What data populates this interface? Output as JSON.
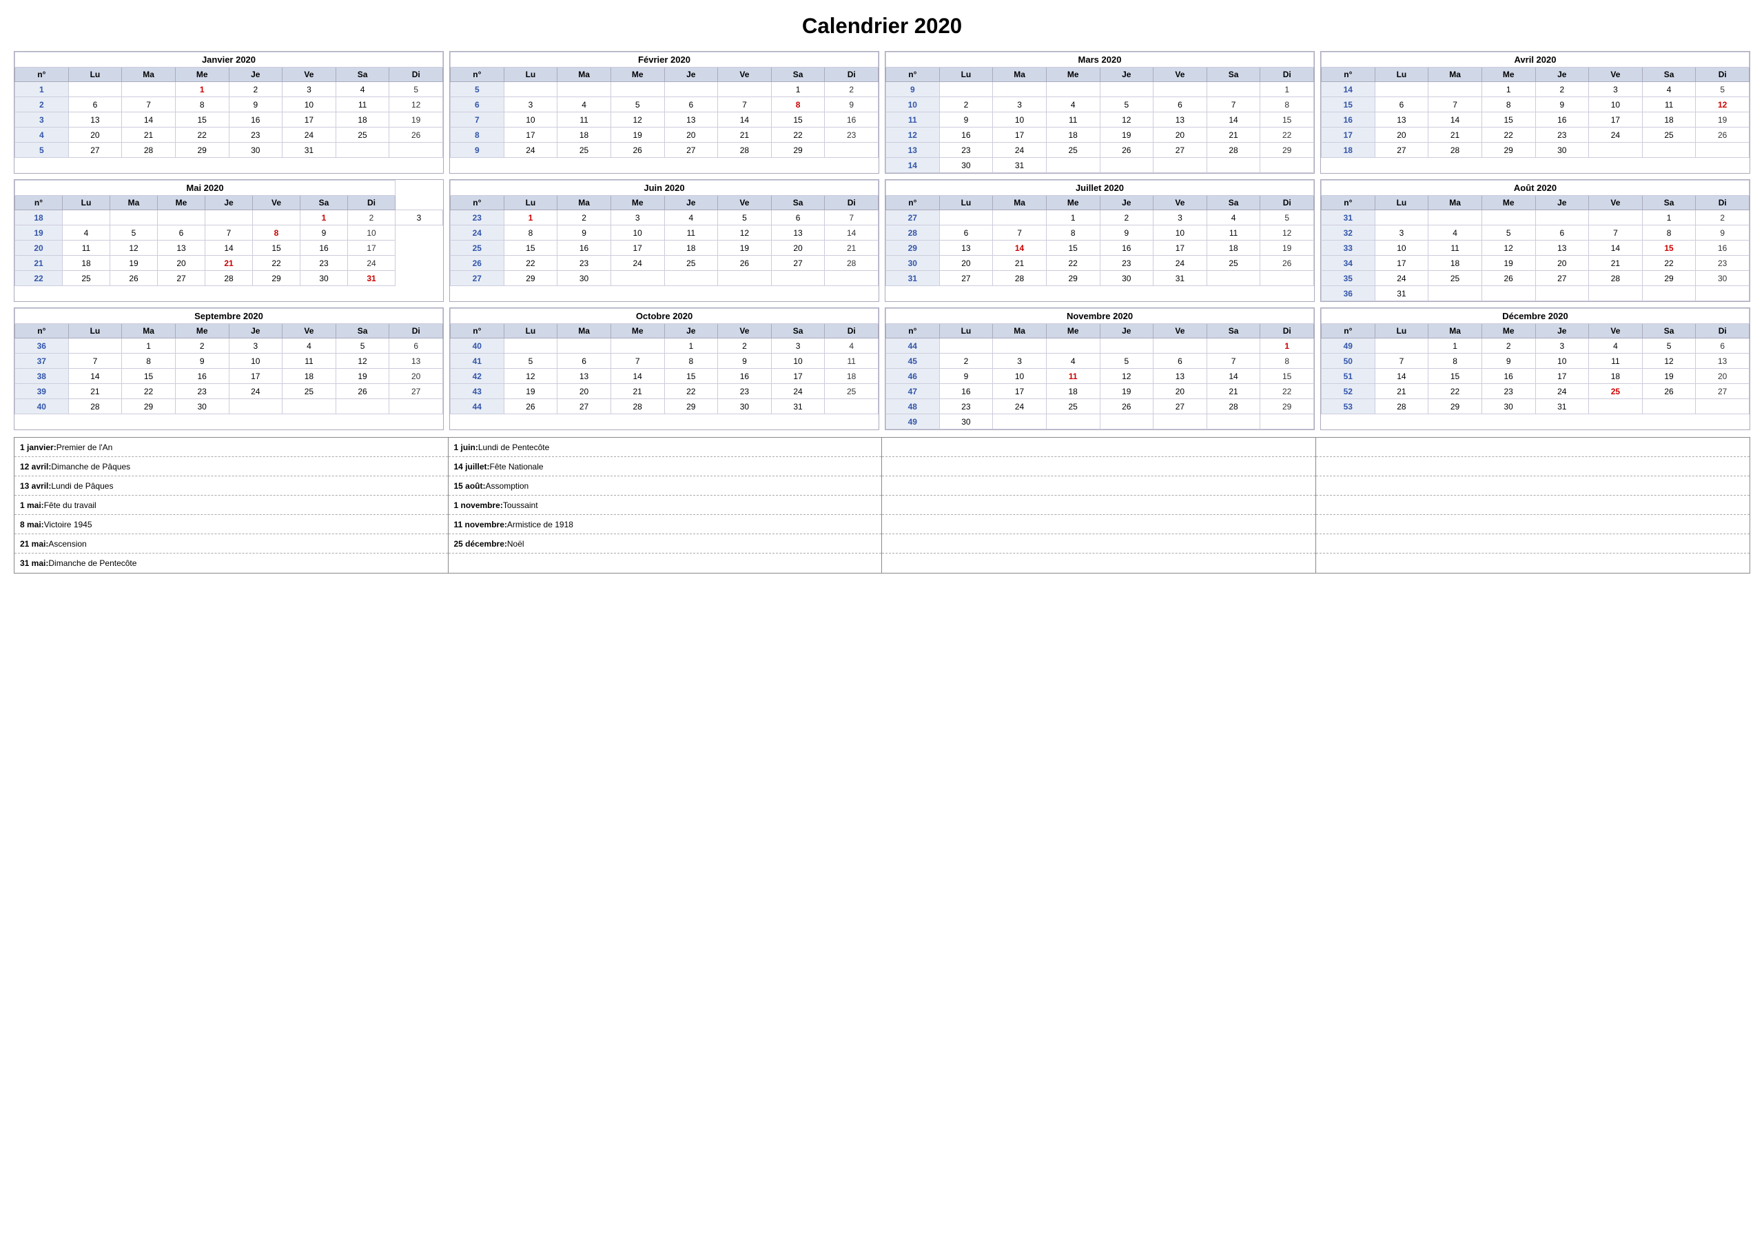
{
  "title": "Calendrier 2020",
  "months": [
    {
      "name": "Janvier 2020",
      "weeks": [
        {
          "wn": 1,
          "days": [
            "",
            "",
            "",
            "1r",
            "2",
            "3",
            "4",
            "5"
          ]
        },
        {
          "wn": 2,
          "days": [
            "",
            "6",
            "7",
            "8",
            "9",
            "10",
            "11",
            "12"
          ]
        },
        {
          "wn": 3,
          "days": [
            "",
            "13",
            "14",
            "15",
            "16",
            "17",
            "18",
            "19"
          ]
        },
        {
          "wn": 4,
          "days": [
            "",
            "20",
            "21",
            "22",
            "23",
            "24",
            "25",
            "26"
          ]
        },
        {
          "wn": 5,
          "days": [
            "",
            "27",
            "28",
            "29",
            "30",
            "31",
            "",
            ""
          ]
        }
      ]
    },
    {
      "name": "Février 2020",
      "weeks": [
        {
          "wn": 5,
          "days": [
            "",
            "",
            "",
            "",
            "",
            "",
            "1",
            "2"
          ]
        },
        {
          "wn": 6,
          "days": [
            "",
            "3",
            "4",
            "5",
            "6",
            "7",
            "8r",
            "9"
          ]
        },
        {
          "wn": 7,
          "days": [
            "",
            "10",
            "11",
            "12",
            "13",
            "14",
            "15",
            "16"
          ]
        },
        {
          "wn": 8,
          "days": [
            "",
            "17",
            "18",
            "19",
            "20",
            "21",
            "22",
            "23"
          ]
        },
        {
          "wn": 9,
          "days": [
            "",
            "24",
            "25",
            "26",
            "27",
            "28",
            "29",
            ""
          ]
        }
      ]
    },
    {
      "name": "Mars 2020",
      "weeks": [
        {
          "wn": 9,
          "days": [
            "",
            "",
            "",
            "",
            "",
            "",
            "",
            "1"
          ]
        },
        {
          "wn": 10,
          "days": [
            "",
            "2",
            "3",
            "4",
            "5",
            "6",
            "7",
            "8"
          ]
        },
        {
          "wn": 11,
          "days": [
            "",
            "9",
            "10",
            "11",
            "12",
            "13",
            "14",
            "15"
          ]
        },
        {
          "wn": 12,
          "days": [
            "",
            "16",
            "17",
            "18",
            "19",
            "20",
            "21",
            "22"
          ]
        },
        {
          "wn": 13,
          "days": [
            "",
            "23",
            "24",
            "25",
            "26",
            "27",
            "28",
            "29"
          ]
        },
        {
          "wn": 14,
          "days": [
            "",
            "30",
            "31",
            "",
            "",
            "",
            "",
            ""
          ]
        }
      ]
    },
    {
      "name": "Avril 2020",
      "weeks": [
        {
          "wn": 14,
          "days": [
            "",
            "",
            "",
            "1",
            "2",
            "3",
            "4",
            "5"
          ]
        },
        {
          "wn": 15,
          "days": [
            "",
            "6",
            "7",
            "8",
            "9",
            "10",
            "11",
            "12r"
          ]
        },
        {
          "wn": 16,
          "days": [
            "",
            "13",
            "14",
            "15",
            "16",
            "17",
            "18",
            "19"
          ]
        },
        {
          "wn": 17,
          "days": [
            "",
            "20",
            "21",
            "22",
            "23",
            "24",
            "25",
            "26"
          ]
        },
        {
          "wn": 18,
          "days": [
            "",
            "27",
            "28",
            "29",
            "30",
            "",
            "",
            ""
          ]
        }
      ]
    },
    {
      "name": "Mai 2020",
      "weeks": [
        {
          "wn": 18,
          "days": [
            "",
            "",
            "",
            "",
            "",
            "",
            "1r",
            "2",
            "3"
          ]
        },
        {
          "wn": 19,
          "days": [
            "",
            "4",
            "5",
            "6",
            "7",
            "8r",
            "9",
            "10"
          ]
        },
        {
          "wn": 20,
          "days": [
            "",
            "11",
            "12",
            "13",
            "14",
            "15",
            "16",
            "17"
          ]
        },
        {
          "wn": 21,
          "days": [
            "",
            "18",
            "19",
            "20",
            "21r",
            "22",
            "23",
            "24"
          ]
        },
        {
          "wn": 22,
          "days": [
            "",
            "25",
            "26",
            "27",
            "28",
            "29",
            "30",
            "31r"
          ]
        }
      ]
    },
    {
      "name": "Juin 2020",
      "weeks": [
        {
          "wn": 23,
          "days": [
            "",
            "1r",
            "2",
            "3",
            "4",
            "5",
            "6",
            "7"
          ]
        },
        {
          "wn": 24,
          "days": [
            "",
            "8",
            "9",
            "10",
            "11",
            "12",
            "13",
            "14"
          ]
        },
        {
          "wn": 25,
          "days": [
            "",
            "15",
            "16",
            "17",
            "18",
            "19",
            "20",
            "21"
          ]
        },
        {
          "wn": 26,
          "days": [
            "",
            "22",
            "23",
            "24",
            "25",
            "26",
            "27",
            "28"
          ]
        },
        {
          "wn": 27,
          "days": [
            "",
            "29",
            "30",
            "",
            "",
            "",
            "",
            ""
          ]
        }
      ]
    },
    {
      "name": "Juillet 2020",
      "weeks": [
        {
          "wn": 27,
          "days": [
            "",
            "",
            "",
            "1",
            "2",
            "3",
            "4",
            "5"
          ]
        },
        {
          "wn": 28,
          "days": [
            "",
            "6",
            "7",
            "8",
            "9",
            "10",
            "11",
            "12"
          ]
        },
        {
          "wn": 29,
          "days": [
            "",
            "13",
            "14r",
            "15",
            "16",
            "17",
            "18",
            "19"
          ]
        },
        {
          "wn": 30,
          "days": [
            "",
            "20",
            "21",
            "22",
            "23",
            "24",
            "25",
            "26"
          ]
        },
        {
          "wn": 31,
          "days": [
            "",
            "27",
            "28",
            "29",
            "30",
            "31",
            "",
            ""
          ]
        }
      ]
    },
    {
      "name": "Août 2020",
      "weeks": [
        {
          "wn": 31,
          "days": [
            "",
            "",
            "",
            "",
            "",
            "",
            "1",
            "2"
          ]
        },
        {
          "wn": 32,
          "days": [
            "",
            "3",
            "4",
            "5",
            "6",
            "7",
            "8",
            "9"
          ]
        },
        {
          "wn": 33,
          "days": [
            "",
            "10",
            "11",
            "12",
            "13",
            "14",
            "15r",
            "16"
          ]
        },
        {
          "wn": 34,
          "days": [
            "",
            "17",
            "18",
            "19",
            "20",
            "21",
            "22",
            "23"
          ]
        },
        {
          "wn": 35,
          "days": [
            "",
            "24",
            "25",
            "26",
            "27",
            "28",
            "29",
            "30"
          ]
        },
        {
          "wn": 36,
          "days": [
            "",
            "31",
            "",
            "",
            "",
            "",
            "",
            ""
          ]
        }
      ]
    },
    {
      "name": "Septembre 2020",
      "weeks": [
        {
          "wn": 36,
          "days": [
            "",
            "",
            "1",
            "2",
            "3",
            "4",
            "5",
            "6"
          ]
        },
        {
          "wn": 37,
          "days": [
            "",
            "7",
            "8",
            "9",
            "10",
            "11",
            "12",
            "13"
          ]
        },
        {
          "wn": 38,
          "days": [
            "",
            "14",
            "15",
            "16",
            "17",
            "18",
            "19",
            "20"
          ]
        },
        {
          "wn": 39,
          "days": [
            "",
            "21",
            "22",
            "23",
            "24",
            "25",
            "26",
            "27"
          ]
        },
        {
          "wn": 40,
          "days": [
            "",
            "28",
            "29",
            "30",
            "",
            "",
            "",
            ""
          ]
        }
      ]
    },
    {
      "name": "Octobre 2020",
      "weeks": [
        {
          "wn": 40,
          "days": [
            "",
            "",
            "",
            "",
            "1",
            "2",
            "3",
            "4"
          ]
        },
        {
          "wn": 41,
          "days": [
            "",
            "5",
            "6",
            "7",
            "8",
            "9",
            "10",
            "11"
          ]
        },
        {
          "wn": 42,
          "days": [
            "",
            "12",
            "13",
            "14",
            "15",
            "16",
            "17",
            "18"
          ]
        },
        {
          "wn": 43,
          "days": [
            "",
            "19",
            "20",
            "21",
            "22",
            "23",
            "24",
            "25"
          ]
        },
        {
          "wn": 44,
          "days": [
            "",
            "26",
            "27",
            "28",
            "29",
            "30",
            "31",
            ""
          ]
        }
      ]
    },
    {
      "name": "Novembre 2020",
      "weeks": [
        {
          "wn": 44,
          "days": [
            "",
            "",
            "",
            "",
            "",
            "",
            "",
            "1r"
          ]
        },
        {
          "wn": 45,
          "days": [
            "",
            "2",
            "3",
            "4",
            "5",
            "6",
            "7",
            "8"
          ]
        },
        {
          "wn": 46,
          "days": [
            "",
            "9",
            "10",
            "11r",
            "12",
            "13",
            "14",
            "15"
          ]
        },
        {
          "wn": 47,
          "days": [
            "",
            "16",
            "17",
            "18",
            "19",
            "20",
            "21",
            "22"
          ]
        },
        {
          "wn": 48,
          "days": [
            "",
            "23",
            "24",
            "25",
            "26",
            "27",
            "28",
            "29"
          ]
        },
        {
          "wn": 49,
          "days": [
            "",
            "30",
            "",
            "",
            "",
            "",
            "",
            ""
          ]
        }
      ]
    },
    {
      "name": "Décembre 2020",
      "weeks": [
        {
          "wn": 49,
          "days": [
            "",
            "",
            "1",
            "2",
            "3",
            "4",
            "5",
            "6"
          ]
        },
        {
          "wn": 50,
          "days": [
            "",
            "7",
            "8",
            "9",
            "10",
            "11",
            "12",
            "13"
          ]
        },
        {
          "wn": 51,
          "days": [
            "",
            "14",
            "15",
            "16",
            "17",
            "18",
            "19",
            "20"
          ]
        },
        {
          "wn": 52,
          "days": [
            "",
            "21",
            "22",
            "23",
            "24",
            "25r",
            "26",
            "27"
          ]
        },
        {
          "wn": 53,
          "days": [
            "",
            "28",
            "29",
            "30",
            "31",
            "",
            "",
            ""
          ]
        }
      ]
    }
  ],
  "col_headers": [
    "n°",
    "Lu",
    "Ma",
    "Me",
    "Je",
    "Ve",
    "Sa",
    "Di"
  ],
  "holidays": {
    "col1": [
      {
        "bold": "1 janvier:",
        "text": " Premier de l'An"
      },
      {
        "bold": "12 avril:",
        "text": " Dimanche de Pâques"
      },
      {
        "bold": "13 avril:",
        "text": " Lundi de Pâques"
      },
      {
        "bold": "1 mai:",
        "text": " Fête du travail"
      },
      {
        "bold": "8 mai:",
        "text": " Victoire 1945"
      },
      {
        "bold": "21 mai:",
        "text": " Ascension"
      },
      {
        "bold": "31 mai:",
        "text": " Dimanche de Pentecôte"
      }
    ],
    "col2": [
      {
        "bold": "1 juin:",
        "text": " Lundi de Pentecôte"
      },
      {
        "bold": "14 juillet:",
        "text": " Fête Nationale"
      },
      {
        "bold": "15 août:",
        "text": " Assomption"
      },
      {
        "bold": "1 novembre:",
        "text": " Toussaint"
      },
      {
        "bold": "11 novembre:",
        "text": " Armistice de 1918"
      },
      {
        "bold": "25 décembre:",
        "text": " Noël"
      },
      {
        "bold": "",
        "text": ""
      }
    ],
    "col3": [],
    "col4": []
  }
}
